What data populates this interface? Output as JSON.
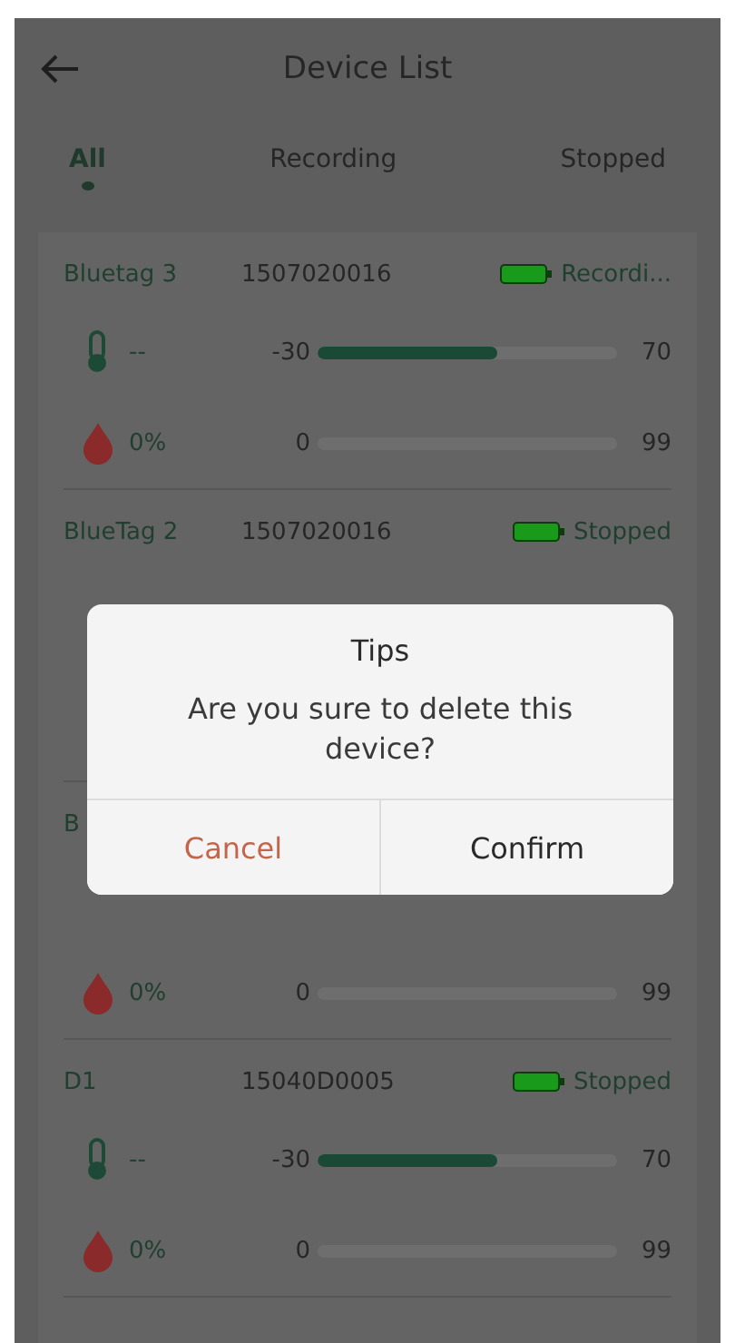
{
  "header": {
    "title": "Device List"
  },
  "tabs": [
    {
      "label": "All",
      "selected": true
    },
    {
      "label": "Recording",
      "selected": false
    },
    {
      "label": "Stopped",
      "selected": false
    }
  ],
  "devices": [
    {
      "name": "Bluetag 3",
      "serial": "1507020016",
      "status": "Recordi...",
      "rows": [
        {
          "kind": "temperature",
          "value": "--",
          "min": "-30",
          "max": "70",
          "level": 0.6
        },
        {
          "kind": "humidity",
          "value": "0%",
          "min": "0",
          "max": "99",
          "level": 0
        }
      ]
    },
    {
      "name": "BlueTag 2",
      "serial": "1507020016",
      "status": "Stopped"
    },
    {
      "name": "B",
      "rows": [
        {
          "kind": "humidity",
          "value": "0%",
          "min": "0",
          "max": "99",
          "level": 0
        }
      ]
    },
    {
      "name": "D1",
      "serial": "15040D0005",
      "status": "Stopped",
      "rows": [
        {
          "kind": "temperature",
          "value": "--",
          "min": "-30",
          "max": "70",
          "level": 0.6
        },
        {
          "kind": "humidity",
          "value": "0%",
          "min": "0",
          "max": "99",
          "level": 0
        }
      ]
    }
  ],
  "dialog": {
    "title": "Tips",
    "message": "Are you sure to delete this device?",
    "buttons": [
      {
        "label": "Cancel",
        "kind": "cancel"
      },
      {
        "label": "Confirm",
        "kind": "confirm"
      }
    ]
  }
}
